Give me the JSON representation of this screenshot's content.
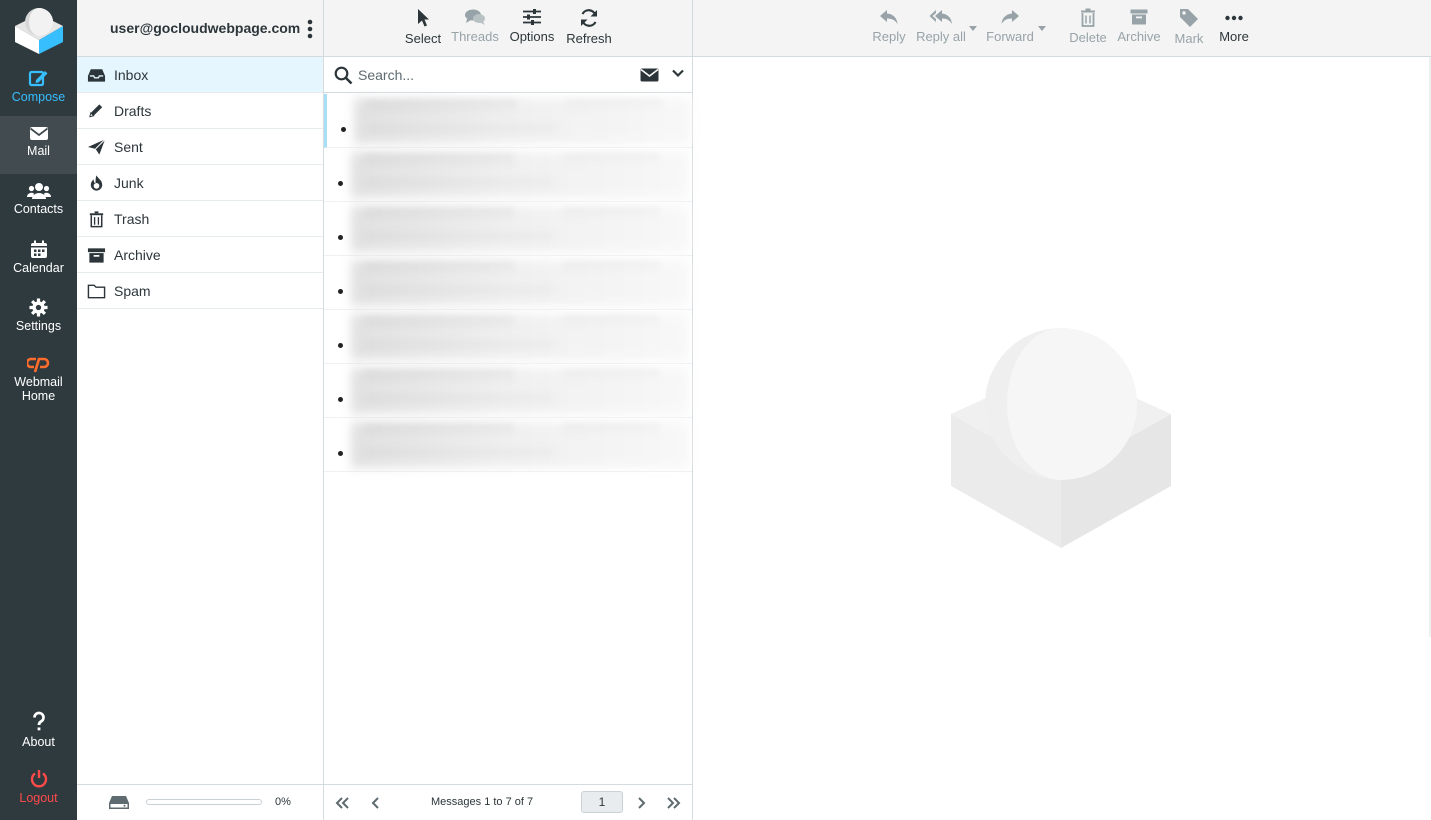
{
  "account": {
    "email": "user@gocloudwebpage.com"
  },
  "taskmenu": {
    "compose": "Compose",
    "mail": "Mail",
    "contacts": "Contacts",
    "calendar": "Calendar",
    "settings": "Settings",
    "webmail_home_line1": "Webmail",
    "webmail_home_line2": "Home",
    "about": "About",
    "logout": "Logout"
  },
  "folders": [
    {
      "name": "Inbox",
      "icon": "inbox-icon",
      "active": true
    },
    {
      "name": "Drafts",
      "icon": "pencil-icon"
    },
    {
      "name": "Sent",
      "icon": "paper-plane-icon"
    },
    {
      "name": "Junk",
      "icon": "fire-icon"
    },
    {
      "name": "Trash",
      "icon": "trash-icon"
    },
    {
      "name": "Archive",
      "icon": "archive-box-icon"
    },
    {
      "name": "Spam",
      "icon": "folder-icon"
    }
  ],
  "quota": {
    "percent_text": "0%",
    "used_fraction": 0
  },
  "list_toolbar": {
    "select": "Select",
    "threads": "Threads",
    "options": "Options",
    "refresh": "Refresh"
  },
  "search": {
    "placeholder": "Search...",
    "value": ""
  },
  "messages_count": 7,
  "list_footer": {
    "count_text": "Messages 1 to 7 of 7",
    "page": "1"
  },
  "content_toolbar": {
    "reply": "Reply",
    "reply_all": "Reply all",
    "forward": "Forward",
    "delete": "Delete",
    "archive": "Archive",
    "mark": "Mark",
    "more": "More"
  },
  "colors": {
    "sidebar_bg": "#2f3a3f",
    "accent": "#37beff",
    "logout": "#ff4a4a",
    "active_folder_bg": "#e5f6ff",
    "cpanel": "#ff6c2c"
  }
}
